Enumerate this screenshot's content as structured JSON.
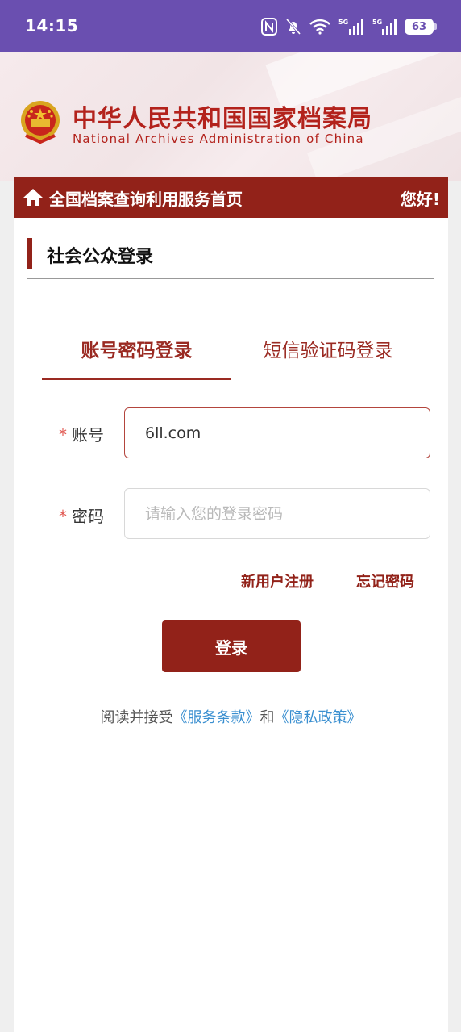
{
  "status_bar": {
    "time": "14:15",
    "battery": "63",
    "network": "5G",
    "icons": [
      "nfc-icon",
      "bell-muted-icon",
      "wifi-icon",
      "signal-5g-icon",
      "signal-5g-icon-2",
      "battery-icon"
    ]
  },
  "banner": {
    "title": "中华人民共和国国家档案局",
    "subtitle": "National Archives Administration of China"
  },
  "nav": {
    "home_label": "全国档案查询利用服务首页",
    "greeting": "您好!"
  },
  "section": {
    "title": "社会公众登录"
  },
  "tabs": [
    {
      "label": "账号密码登录",
      "active": true
    },
    {
      "label": "短信验证码登录",
      "active": false
    }
  ],
  "form": {
    "required_mark": "*",
    "account": {
      "label": "账号",
      "value": "6ll.com"
    },
    "password": {
      "label": "密码",
      "placeholder": "请输入您的登录密码"
    }
  },
  "links": {
    "register": "新用户注册",
    "forgot": "忘记密码"
  },
  "login_button": "登录",
  "agreement": {
    "prefix": "阅读并接受",
    "terms": "《服务条款》",
    "and": "和",
    "privacy": "《隐私政策》"
  },
  "colors": {
    "status_bar": "#6a4fb0",
    "brand_red": "#922219",
    "title_red": "#b3221c",
    "link_blue": "#3a8fd0"
  }
}
